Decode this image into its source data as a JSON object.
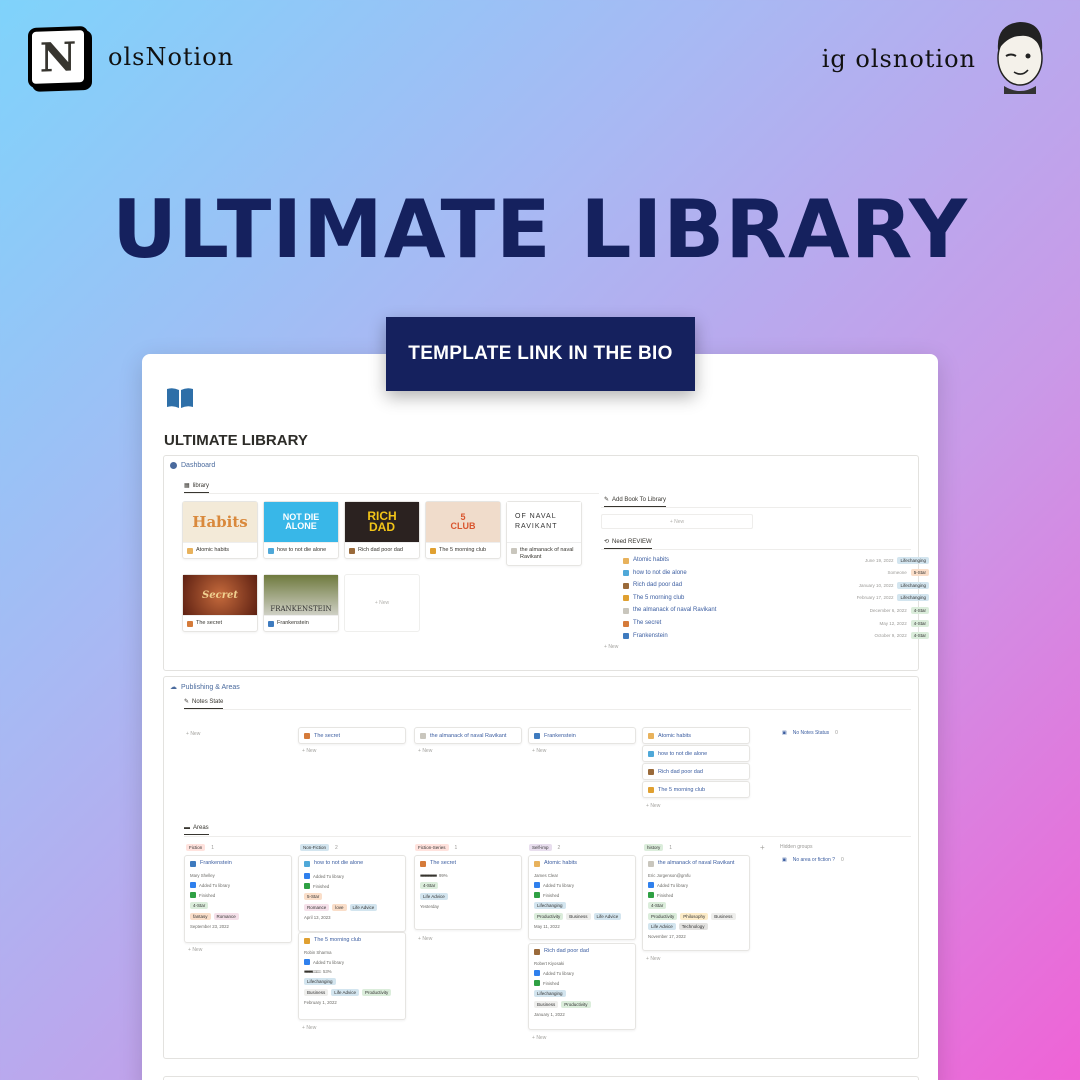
{
  "brand": {
    "logo_letter": "N",
    "name": "olsNotion",
    "handle": "ig olsnotion"
  },
  "headline": "ULTIMATE LIBRARY",
  "cta": "TEMPLATE LINK IN THE BIO",
  "page": {
    "title": "ULTIMATE LIBRARY"
  },
  "dashboard": {
    "title": "Dashboard",
    "tab": "library",
    "books": [
      {
        "name": "Atomic habits",
        "cover": "Habits"
      },
      {
        "name": "how to not die alone",
        "cover": "NOT DIE ALONE"
      },
      {
        "name": "Rich dad poor dad",
        "cover": "RICH DAD"
      },
      {
        "name": "The 5 morning club",
        "cover": "5 CLUB"
      },
      {
        "name": "the almanack of naval Ravikant",
        "cover": "OF NAVAL RAVIKANT"
      },
      {
        "name": "The secret",
        "cover": "Secret"
      },
      {
        "name": "Frankenstein",
        "cover": "FRANKENSTEIN"
      }
    ],
    "new_label": "New",
    "add_book": "Add Book To Library",
    "need_review": "Need REVIEW",
    "reviews": [
      {
        "name": "Atomic habits",
        "date": "June 19, 2022",
        "tag": "Lifechanging",
        "color": "#d3e5ef"
      },
      {
        "name": "how to not die alone",
        "date": "Someone",
        "tag": "5-Star",
        "color": "#fadec9"
      },
      {
        "name": "Rich dad poor dad",
        "date": "January 10, 2022",
        "tag": "Lifechanging",
        "color": "#d3e5ef"
      },
      {
        "name": "The 5 morning club",
        "date": "February 17, 2022",
        "tag": "Lifechanging",
        "color": "#d3e5ef"
      },
      {
        "name": "the almanack of naval Ravikant",
        "date": "December 6, 2022",
        "tag": "4-Star",
        "color": "#dbeddb"
      },
      {
        "name": "The secret",
        "date": "May 12, 2022",
        "tag": "4-Star",
        "color": "#dbeddb"
      },
      {
        "name": "Frankenstein",
        "date": "October 9, 2022",
        "tag": "4-Star",
        "color": "#dbeddb"
      }
    ]
  },
  "publishing": {
    "title": "Publishing & Areas",
    "tab": "Notes State",
    "new_label": "New",
    "kanban": [
      {
        "cards": []
      },
      {
        "cards": [
          "The secret"
        ]
      },
      {
        "cards": [
          "the almanack of naval Ravikant"
        ]
      },
      {
        "cards": [
          "Frankenstein"
        ]
      },
      {
        "cards": [
          "Atomic habits",
          "how to not die alone",
          "Rich dad poor dad",
          "The 5 morning club"
        ]
      }
    ],
    "no_status": "No Notes Status",
    "no_status_count": "0",
    "areas_tab": "Areas",
    "columns": [
      {
        "name": "Fiction",
        "count": "1",
        "color": "#ffe2dd"
      },
      {
        "name": "Non-Fiction",
        "count": "2",
        "color": "#d3e5ef"
      },
      {
        "name": "Fiction-Series",
        "count": "1",
        "color": "#ffe2dd"
      },
      {
        "name": "Self-imp",
        "count": "2",
        "color": "#e8deee"
      },
      {
        "name": "history",
        "count": "1",
        "color": "#dbeddb"
      }
    ],
    "hidden_groups": "Hidden groups",
    "hidden_item": "No area or fiction ?",
    "hidden_count": "0",
    "cards": {
      "frankenstein": {
        "title": "Frankenstein",
        "author": "Mary Shelley",
        "added": "Added To library",
        "finished": "Finished",
        "rating": "4-Star",
        "tags": [
          "fantasy",
          "Romance"
        ],
        "date": "September 23, 2022"
      },
      "notdie": {
        "title": "how to not die alone",
        "added": "Added To library",
        "finished": "Finished",
        "rating": "5-Star",
        "tags": [
          "Romance",
          "love",
          "Life Advice"
        ],
        "date": "April 13, 2023"
      },
      "club": {
        "title": "The 5 morning club",
        "author": "Robin Sharma",
        "added": "Added To library",
        "progress": "53%",
        "tags": [
          "Lifechanging"
        ],
        "tags2": [
          "Business",
          "Life Advice",
          "Productivity"
        ],
        "date": "February 1, 2022"
      },
      "secret": {
        "title": "The secret",
        "progress": "99%",
        "rating": "4-Star",
        "tags": [
          "Life Advice"
        ],
        "date": "Yesterday"
      },
      "atomic": {
        "title": "Atomic habits",
        "author": "James Clear",
        "added": "Added To library",
        "finished": "Finished",
        "tags": [
          "Lifechanging"
        ],
        "tags2": [
          "Productivity",
          "Business",
          "Life Advice"
        ],
        "date": "May 11, 2022"
      },
      "richdad": {
        "title": "Rich dad poor dad",
        "author": "Robert Kiyosaki",
        "added": "Added To library",
        "finished": "Finished",
        "tags": [
          "Lifechanging"
        ],
        "tags2": [
          "Business",
          "Productivity"
        ],
        "date": "January 1, 2022"
      },
      "naval": {
        "title": "the almanack of naval Ravikant",
        "author": "Eric Jorgenson@gmfu",
        "added": "Added To library",
        "finished": "Finished",
        "rating": "4-Star",
        "tags": [
          "Productivity",
          "Philosophy",
          "Business",
          "Life Advice",
          "Technology"
        ],
        "date": "November 17, 2022"
      }
    }
  }
}
